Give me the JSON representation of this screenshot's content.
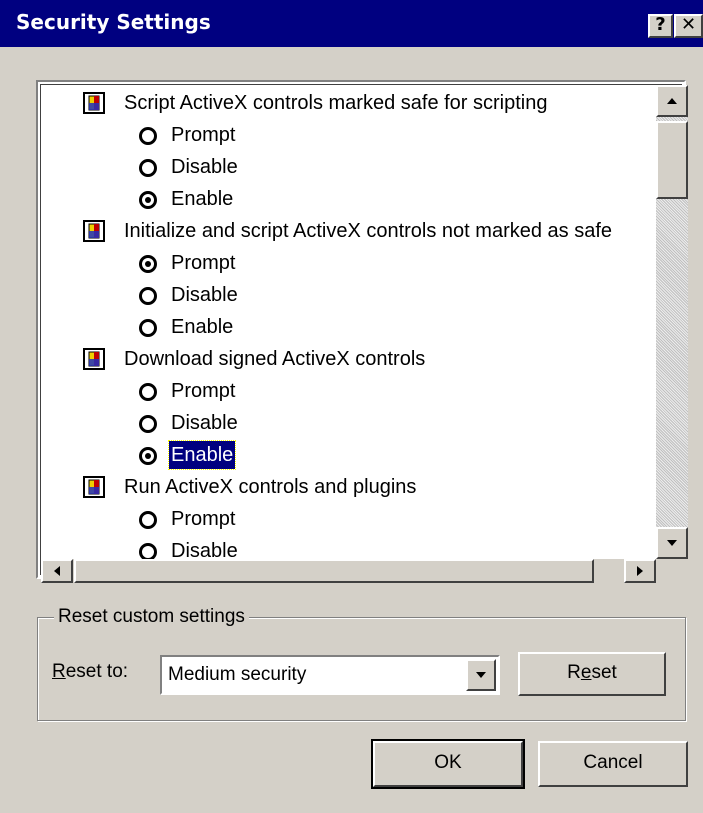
{
  "window": {
    "title": "Security Settings",
    "help_glyph": "?",
    "close_glyph": "✕"
  },
  "settings": [
    {
      "label": "Script ActiveX controls marked safe for scripting",
      "icon": "security-settings-icon",
      "options": [
        {
          "label": "Prompt",
          "checked": false
        },
        {
          "label": "Disable",
          "checked": false
        },
        {
          "label": "Enable",
          "checked": true
        }
      ]
    },
    {
      "label": "Initialize and script ActiveX controls not marked as safe",
      "icon": "security-settings-icon",
      "options": [
        {
          "label": "Prompt",
          "checked": true
        },
        {
          "label": "Disable",
          "checked": false
        },
        {
          "label": "Enable",
          "checked": false
        }
      ]
    },
    {
      "label": "Download signed ActiveX controls",
      "icon": "security-settings-icon",
      "options": [
        {
          "label": "Prompt",
          "checked": false
        },
        {
          "label": "Disable",
          "checked": false
        },
        {
          "label": "Enable",
          "checked": true,
          "selected": true
        }
      ]
    },
    {
      "label": "Run ActiveX controls and plugins",
      "icon": "security-settings-icon",
      "options": [
        {
          "label": "Prompt",
          "checked": false
        },
        {
          "label": "Disable",
          "checked": false
        }
      ]
    }
  ],
  "reset_group": {
    "legend": "Reset custom settings",
    "reset_to_label": "Reset to:",
    "reset_to_value": "Medium security",
    "reset_button": "Reset"
  },
  "footer": {
    "ok": "OK",
    "cancel": "Cancel"
  },
  "colors": {
    "titlebar": "#000080",
    "dialog_face": "#d4d0c8",
    "selection": "#000080"
  }
}
